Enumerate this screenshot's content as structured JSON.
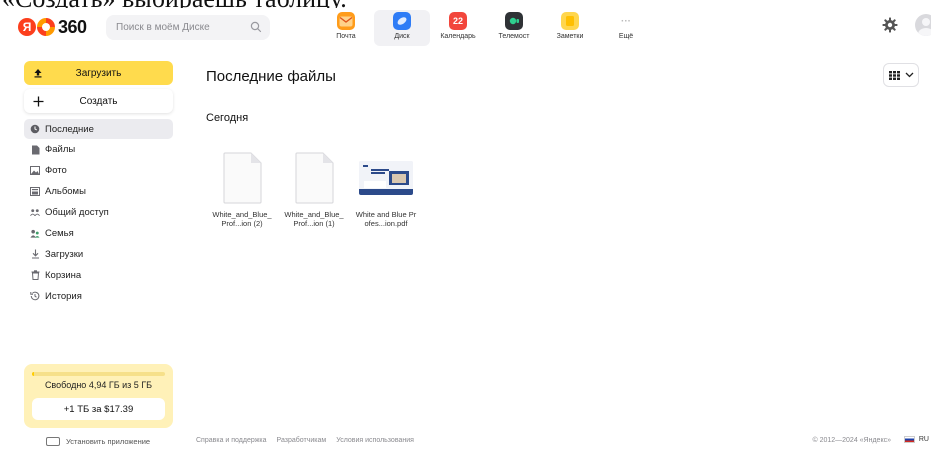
{
  "caption": "«Создать» выбираешь таблицу.",
  "header": {
    "search_placeholder": "Поиск в моём Диске",
    "apps": [
      {
        "label": "Почта",
        "icon": "mail-icon",
        "color": "#ff9c1a"
      },
      {
        "label": "Диск",
        "icon": "disk-icon",
        "color": "#2e7cf6",
        "active": true
      },
      {
        "label": "Календарь",
        "icon": "calendar-icon",
        "color": "#f2463c",
        "badge": "22"
      },
      {
        "label": "Телемост",
        "icon": "telemost-icon",
        "color": "#2f3236"
      },
      {
        "label": "Заметки",
        "icon": "notes-icon",
        "color": "#ffd64d"
      },
      {
        "label": "Ещё",
        "icon": "more-icon",
        "color": "#bbbbbb"
      }
    ]
  },
  "sidebar": {
    "upload_label": "Загрузить",
    "create_label": "Создать",
    "items": [
      {
        "label": "Последние",
        "icon": "clock-icon",
        "active": true
      },
      {
        "label": "Файлы",
        "icon": "file-icon"
      },
      {
        "label": "Фото",
        "icon": "photo-icon"
      },
      {
        "label": "Альбомы",
        "icon": "album-icon"
      },
      {
        "label": "Общий доступ",
        "icon": "shared-icon"
      },
      {
        "label": "Семья",
        "icon": "family-icon"
      },
      {
        "label": "Загрузки",
        "icon": "downloads-icon"
      },
      {
        "label": "Корзина",
        "icon": "trash-icon"
      },
      {
        "label": "История",
        "icon": "history-icon"
      }
    ],
    "storage_text": "Свободно 4,94 ГБ из 5 ГБ",
    "storage_used_fraction": 0.012,
    "buy_label": "+1 ТБ за $17.39",
    "install_label": "Установить приложение"
  },
  "main": {
    "title": "Последние файлы",
    "section": "Сегодня",
    "files": [
      {
        "name": "White_and_Blue_Prof...ion (2)",
        "kind": "doc"
      },
      {
        "name": "White_and_Blue_Prof...ion (1)",
        "kind": "doc"
      },
      {
        "name": "White and Blue Profes...ion.pdf",
        "kind": "pdf"
      }
    ]
  },
  "footer": {
    "links": [
      "Справка и поддержка",
      "Разработчикам",
      "Условия использования"
    ],
    "copyright": "© 2012—2024 «Яндекс»",
    "lang": "RU"
  }
}
